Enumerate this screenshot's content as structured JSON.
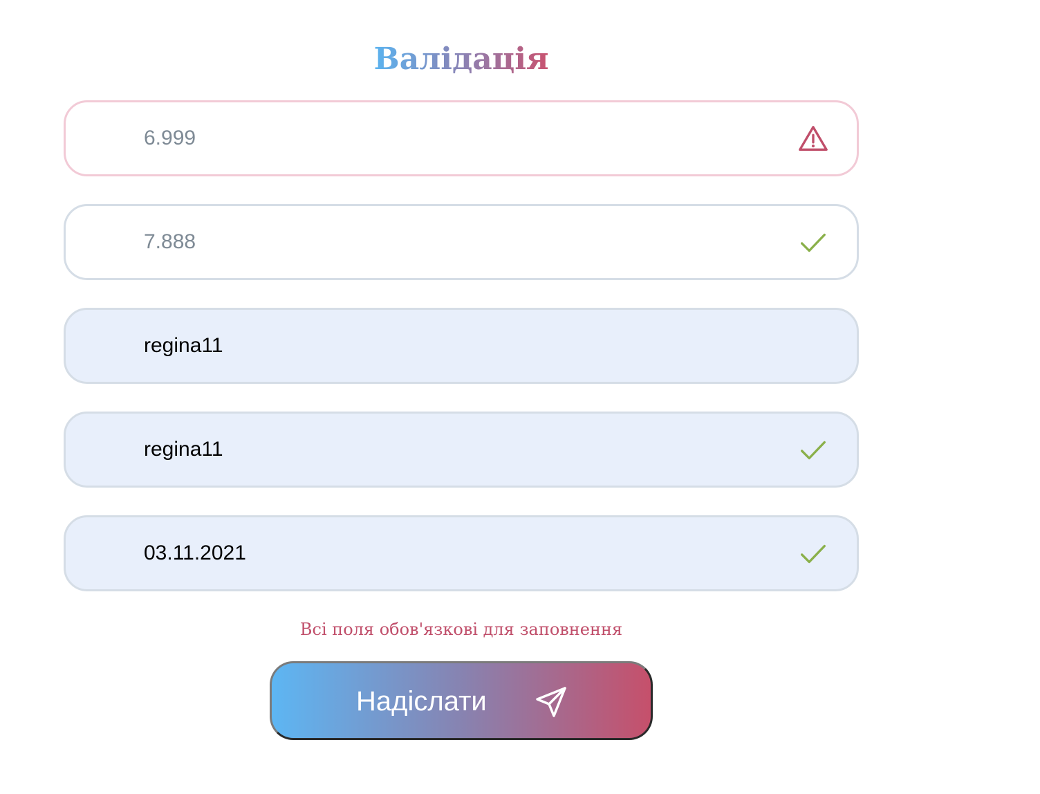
{
  "title": "Валідація",
  "fields": [
    {
      "placeholder": "6.999",
      "value": "",
      "status": "error",
      "icon": "warning-triangle-icon"
    },
    {
      "placeholder": "7.888",
      "value": "",
      "status": "valid",
      "icon": "check-icon"
    },
    {
      "placeholder": "",
      "value": "regina11",
      "status": "none",
      "icon": ""
    },
    {
      "placeholder": "",
      "value": "regina11",
      "status": "valid",
      "icon": "check-icon"
    },
    {
      "placeholder": "",
      "value": "03.11.2021",
      "status": "valid",
      "icon": "check-icon"
    }
  ],
  "hint": "Всі поля обов'язкові для заповнення",
  "submit": {
    "label": "Надіслати",
    "icon": "send-icon"
  },
  "colors": {
    "error": "#c04e6a",
    "valid": "#8ab04a",
    "field_border": "#d5dde6",
    "error_border": "#f2cad6",
    "filled_bg": "#e8effb",
    "gradient_start": "#5db6f3",
    "gradient_end": "#c6506b"
  }
}
